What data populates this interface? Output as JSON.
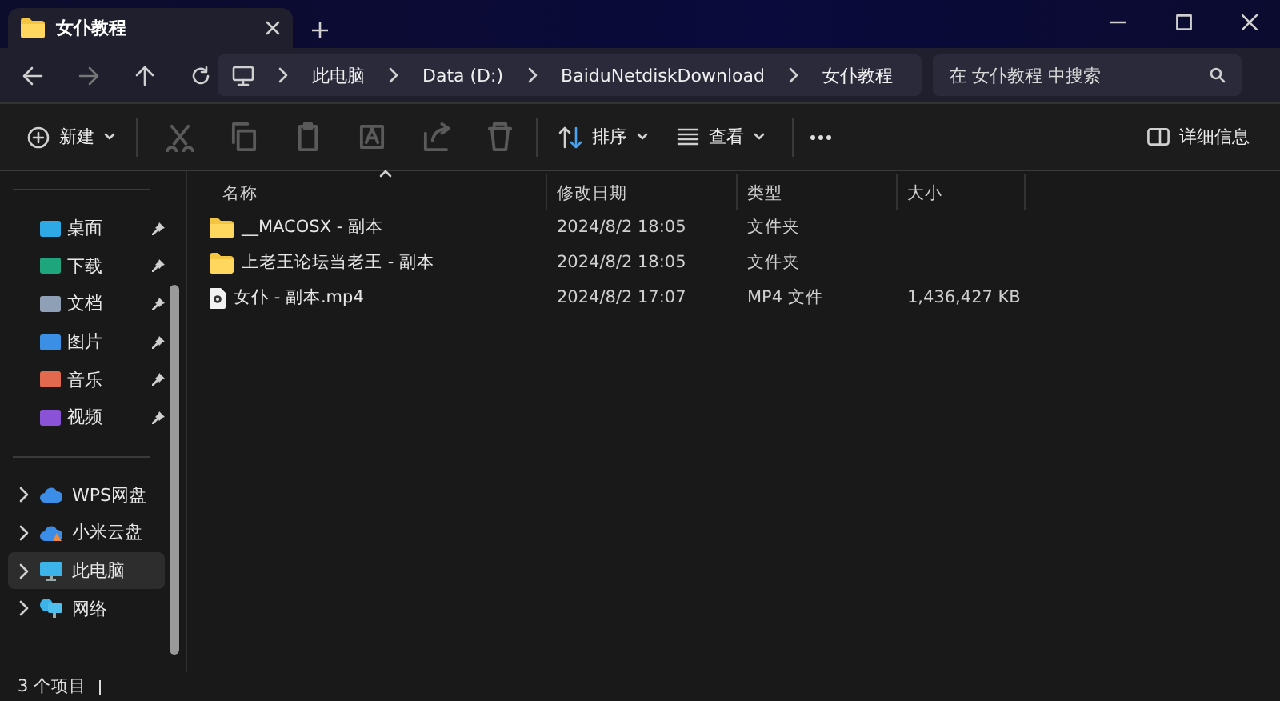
{
  "tab": {
    "title": "女仆教程"
  },
  "breadcrumb": [
    "此电脑",
    "Data (D:)",
    "BaiduNetdiskDownload",
    "女仆教程"
  ],
  "search": {
    "placeholder": "在 女仆教程 中搜索"
  },
  "toolbar": {
    "new": "新建",
    "sort": "排序",
    "view": "查看",
    "details": "详细信息",
    "actions": [
      {
        "kind": "cut",
        "disabled": true
      },
      {
        "kind": "copy",
        "disabled": true
      },
      {
        "kind": "paste",
        "disabled": true
      },
      {
        "kind": "rename",
        "disabled": true
      },
      {
        "kind": "share",
        "disabled": true
      },
      {
        "kind": "delete",
        "disabled": true
      }
    ]
  },
  "sidebar": {
    "quick_access": [
      {
        "label": "桌面",
        "color": "#2fa8e6",
        "pinned": true
      },
      {
        "label": "下载",
        "color": "#1ea57c",
        "pinned": true
      },
      {
        "label": "文档",
        "color": "#8fa0b6",
        "pinned": true
      },
      {
        "label": "图片",
        "color": "#3b8fe4",
        "pinned": true
      },
      {
        "label": "音乐",
        "color": "#e2684e",
        "pinned": true
      },
      {
        "label": "视频",
        "color": "#8a52d6",
        "pinned": true
      }
    ],
    "locations": [
      {
        "label": "WPS网盘",
        "kind": "cloud",
        "selected": false
      },
      {
        "label": "小米云盘",
        "kind": "cloud-orange",
        "selected": false
      },
      {
        "label": "此电脑",
        "kind": "pc",
        "selected": true
      },
      {
        "label": "网络",
        "kind": "network",
        "selected": false
      }
    ]
  },
  "columns": [
    "名称",
    "修改日期",
    "类型",
    "大小"
  ],
  "rows": [
    {
      "kind": "folder",
      "name": "__MACOSX - 副本",
      "modified": "2024/8/2 18:05",
      "type": "文件夹"
    },
    {
      "kind": "folder",
      "name": "上老王论坛当老王 - 副本",
      "modified": "2024/8/2 18:05",
      "type": "文件夹"
    },
    {
      "kind": "video",
      "name": "女仆 - 副本.mp4",
      "modified": "2024/8/2 17:07",
      "type": "MP4 文件",
      "size": "1,436,427 KB"
    }
  ],
  "status_bar": {
    "count": "3 个项目"
  }
}
